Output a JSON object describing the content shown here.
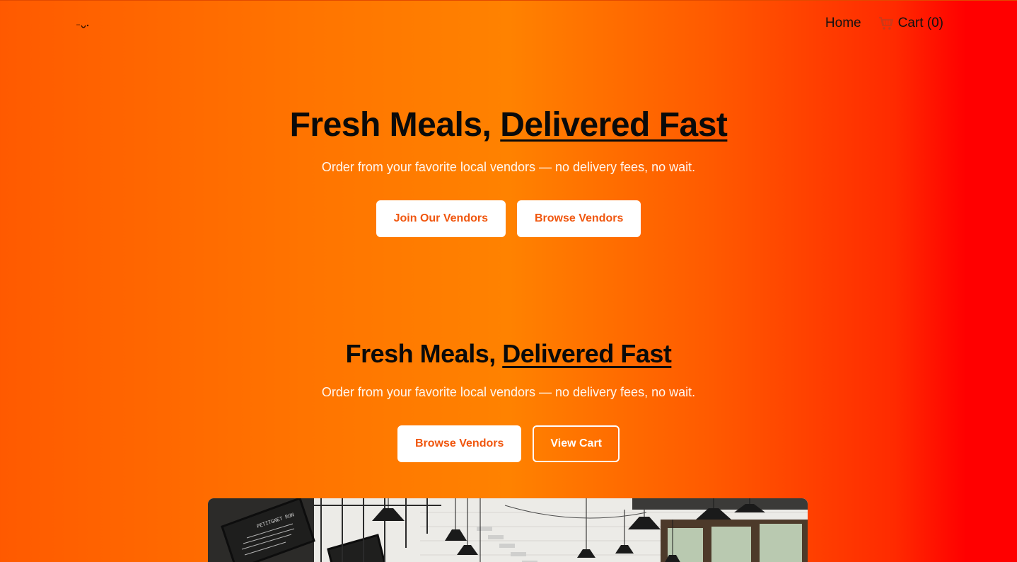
{
  "header": {
    "logo_alt": "logo",
    "nav": {
      "home_label": "Home",
      "cart_label": "Cart (0)"
    }
  },
  "hero_primary": {
    "title_lead": "Fresh Meals,",
    "title_accent": "Delivered Fast",
    "subtitle": "Order from your favorite local vendors — no delivery fees, no wait.",
    "buttons": {
      "join_label": "Join Our Vendors",
      "browse_label": "Browse Vendors"
    }
  },
  "hero_secondary": {
    "title_lead": "Fresh Meals,",
    "title_accent": "Delivered Fast",
    "subtitle": "Order from your favorite local vendors — no delivery fees, no wait.",
    "buttons": {
      "browse_label": "Browse Vendors",
      "view_cart_label": "View Cart"
    }
  },
  "image_panel": {
    "chalkboard_text": "PETITGNET RUN"
  },
  "colors": {
    "brand_orange": "#ff7a00",
    "brand_red": "#ff0000",
    "button_text": "#f0560e"
  },
  "icons": {
    "cart": "shopping-cart-icon",
    "logo": "logo-icon"
  }
}
